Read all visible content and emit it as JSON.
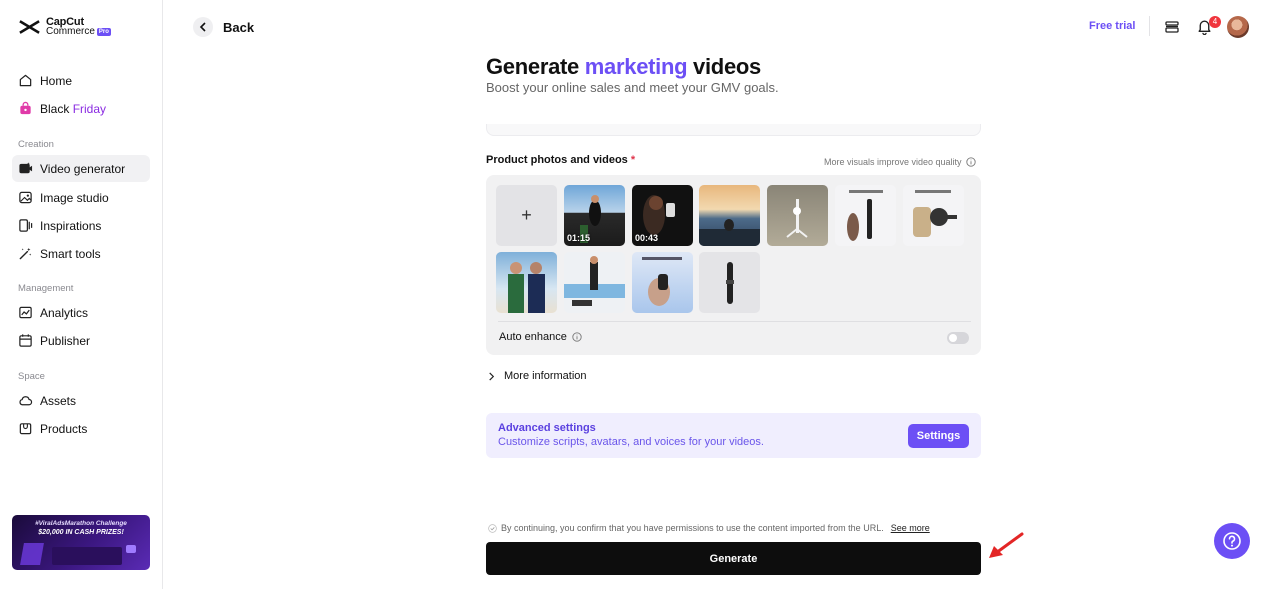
{
  "brand": {
    "name_line1": "CapCut",
    "name_line2": "Commerce",
    "badge": "Pro"
  },
  "sidebar": {
    "items_top": [
      {
        "label": "Home",
        "icon": "home-icon"
      },
      {
        "label_a": "Black ",
        "label_b": "Friday",
        "icon": "shopping-bag-icon"
      }
    ],
    "sections": [
      {
        "title": "Creation",
        "items": [
          {
            "label": "Video generator",
            "icon": "video-generator-icon",
            "active": true
          },
          {
            "label": "Image studio",
            "icon": "image-icon"
          },
          {
            "label": "Inspirations",
            "icon": "inspirations-icon"
          },
          {
            "label": "Smart tools",
            "icon": "magic-wand-icon"
          }
        ]
      },
      {
        "title": "Management",
        "items": [
          {
            "label": "Analytics",
            "icon": "analytics-icon"
          },
          {
            "label": "Publisher",
            "icon": "calendar-icon"
          }
        ]
      },
      {
        "title": "Space",
        "items": [
          {
            "label": "Assets",
            "icon": "cloud-icon"
          },
          {
            "label": "Products",
            "icon": "products-icon"
          }
        ]
      }
    ],
    "promo": {
      "line1": "#ViralAdsMarathon Challenge",
      "line2": "$20,000 IN CASH PRIZES!"
    }
  },
  "header": {
    "back_label": "Back",
    "free_trial": "Free trial",
    "notification_count": "4"
  },
  "main": {
    "title_a": "Generate ",
    "title_accent": "marketing",
    "title_b": " videos",
    "subtitle": "Boost your online sales and meet your GMV goals.",
    "photos_label": "Product photos and videos",
    "required_mark": "*",
    "quality_hint": "More visuals improve video quality",
    "add_symbol": "+",
    "media_tiles": [
      {
        "kind": "video",
        "duration": "01:15"
      },
      {
        "kind": "video",
        "duration": "00:43"
      },
      {
        "kind": "image"
      },
      {
        "kind": "image"
      },
      {
        "kind": "image"
      },
      {
        "kind": "image"
      },
      {
        "kind": "image"
      },
      {
        "kind": "image"
      },
      {
        "kind": "image"
      },
      {
        "kind": "image"
      }
    ],
    "auto_enhance_label": "Auto enhance",
    "auto_enhance_on": false,
    "more_info_label": "More information",
    "advanced": {
      "title": "Advanced settings",
      "description": "Customize scripts, avatars, and voices for your videos.",
      "button": "Settings"
    },
    "consent_text": "By continuing, you confirm that you have permissions to use the content imported from the URL.",
    "see_more": "See more",
    "generate_button": "Generate"
  },
  "colors": {
    "accent": "#6c4ff5",
    "danger": "#f0353d",
    "annotation_arrow": "#e32626"
  }
}
